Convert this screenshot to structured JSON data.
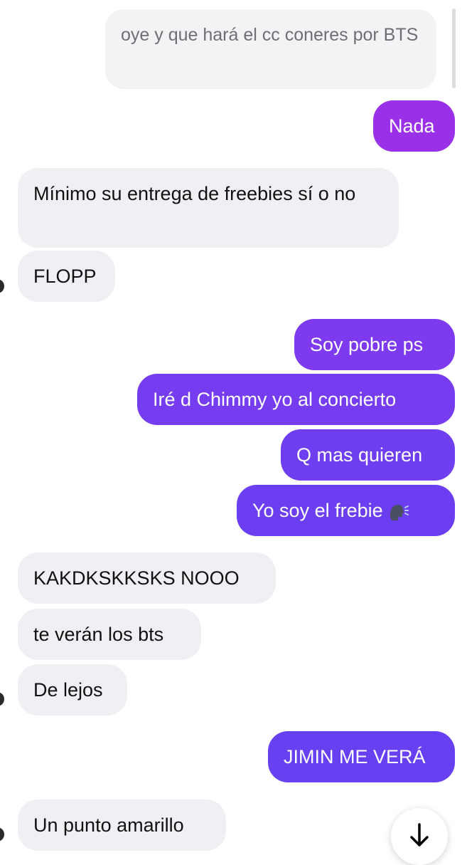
{
  "chat": {
    "quoted": "oye y que hará el cc coneres por BTS",
    "messages": [
      {
        "side": "out",
        "text": "Nada"
      },
      {
        "side": "in",
        "text": "Mínimo su entrega de freebies sí o no"
      },
      {
        "side": "in",
        "text": "FLOPP"
      },
      {
        "side": "out",
        "text": "Soy pobre ps"
      },
      {
        "side": "out",
        "text": "Iré d Chimmy yo al concierto"
      },
      {
        "side": "out",
        "text": "Q mas quieren"
      },
      {
        "side": "out",
        "text": "Yo soy el frebie",
        "emoji": "speaking-head-emoji"
      },
      {
        "side": "in",
        "text": "KAKDKSKKSKS NOOO"
      },
      {
        "side": "in",
        "text": "te verán los bts"
      },
      {
        "side": "in",
        "text": "De lejos"
      },
      {
        "side": "out",
        "text": "JIMIN ME VERÁ"
      },
      {
        "side": "in",
        "text": "Un punto amarillo"
      }
    ]
  },
  "colors": {
    "incoming_bg": "#eff0f3",
    "outgoing_purple": "#8e33ea",
    "outgoing_violet": "#6c3cf0"
  },
  "icons": {
    "scroll_down": "arrow-down-icon"
  }
}
